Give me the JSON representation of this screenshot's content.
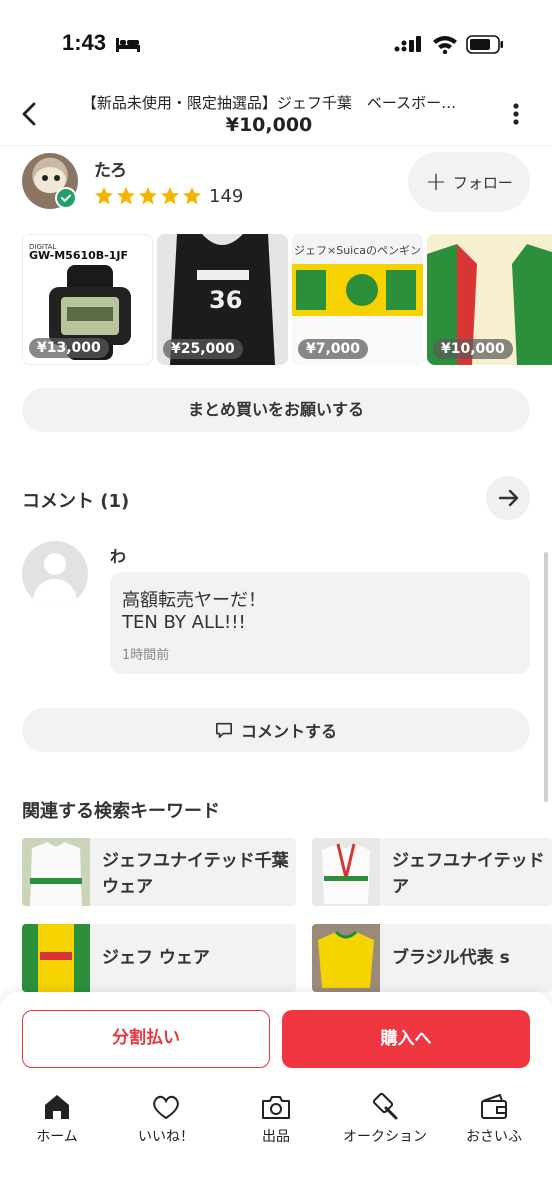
{
  "status_bar": {
    "time": "1:43"
  },
  "header": {
    "title": "【新品未使用・限定抽選品】ジェフ千葉　ベースボー…",
    "price": "¥10,000"
  },
  "seller": {
    "name": "たろ",
    "rating_count": "149",
    "follow_label": "フォロー"
  },
  "products": [
    {
      "price": "¥13,000",
      "label": "GW-M5610B-1JF"
    },
    {
      "price": "¥25,000",
      "label": "36"
    },
    {
      "price": "¥7,000",
      "label": "ジェフ×Suicaのペンギン"
    },
    {
      "price": "¥10,000",
      "label": ""
    }
  ],
  "bulk_button": "まとめ買いをお願いする",
  "comments": {
    "title": "コメント (1)",
    "items": [
      {
        "name": "わ",
        "line1": "高額転売ヤーだ！",
        "line2": "TEN BY ALL!!!",
        "time": "1時間前"
      }
    ],
    "comment_button": "コメントする"
  },
  "keywords": {
    "title": "関連する検索キーワード",
    "items": [
      {
        "label": "ジェフユナイテッド千葉 ウェア"
      },
      {
        "label": "ジェフユナイテッド ウェア"
      },
      {
        "label": "ジェフ ウェア"
      },
      {
        "label": "ブラジル代表 s"
      }
    ]
  },
  "actions": {
    "split": "分割払い",
    "buy": "購入へ"
  },
  "tabs": [
    {
      "label": "ホーム",
      "icon": "home-icon"
    },
    {
      "label": "いいね！",
      "icon": "heart-icon"
    },
    {
      "label": "出品",
      "icon": "camera-icon"
    },
    {
      "label": "オークション",
      "icon": "gavel-icon"
    },
    {
      "label": "おさいふ",
      "icon": "wallet-icon"
    }
  ],
  "colors": {
    "accent": "#ef3641",
    "star": "#f5b400",
    "verified": "#22a06b"
  }
}
